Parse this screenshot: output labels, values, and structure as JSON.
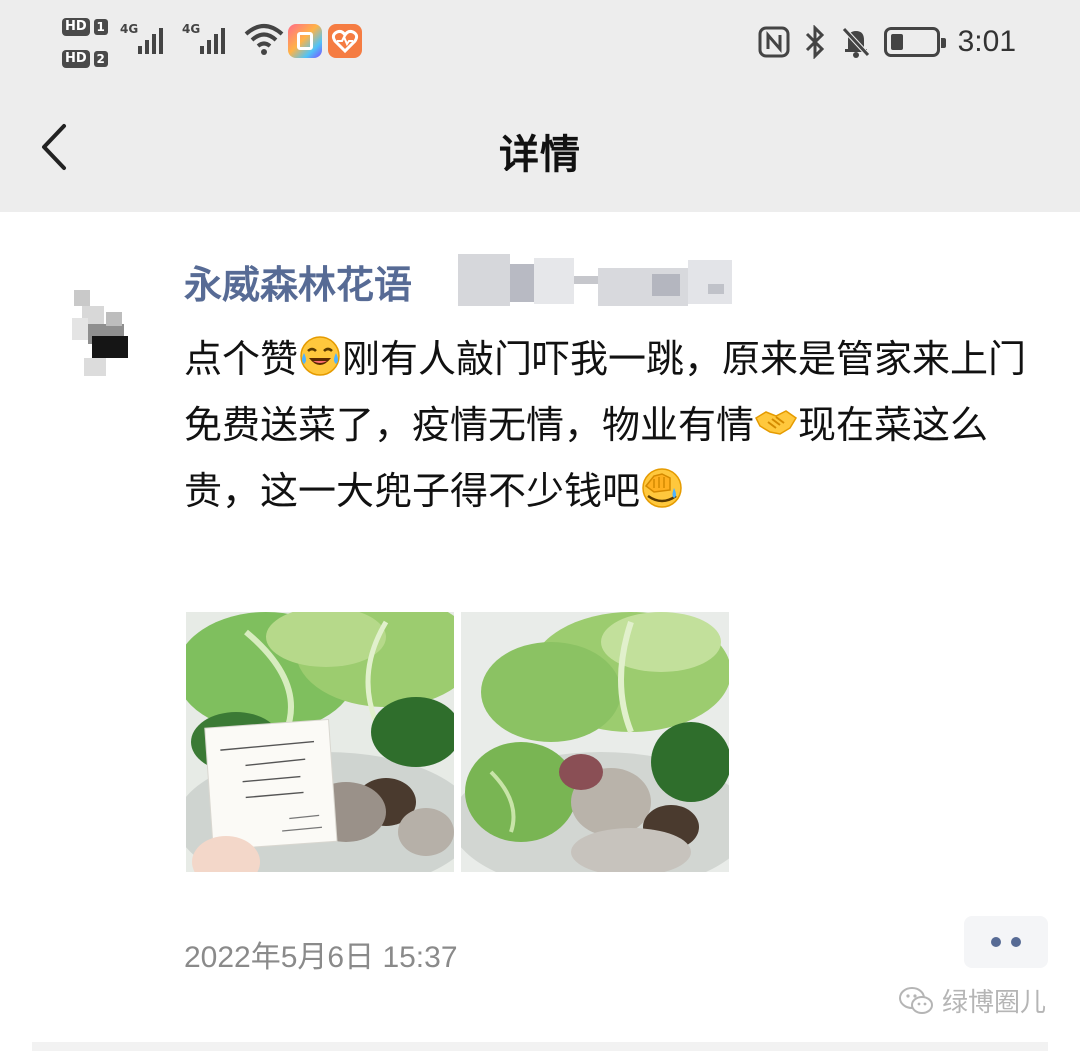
{
  "status_bar": {
    "sim1_badge": "HD",
    "sim1_index": "1",
    "sim2_badge": "HD",
    "sim2_index": "2",
    "network1": "4G",
    "network2": "4G",
    "time": "3:01",
    "icons": [
      "signal-4g-icon",
      "signal-4g-icon",
      "wifi-icon",
      "app-notify-icon",
      "health-app-icon",
      "nfc-icon",
      "bluetooth-icon",
      "mute-bell-icon",
      "battery-icon"
    ]
  },
  "nav": {
    "title": "详情",
    "back_icon": "chevron-left-icon"
  },
  "post": {
    "author": "永威森林花语",
    "text_segments": [
      "点个赞",
      "刚有人敲门吓我一跳，原来是管家来上门免费送菜了，疫情无情，物业有情",
      "现在菜这么贵，这一大兜子得不少钱吧"
    ],
    "emojis": [
      "laughing-tears-emoji",
      "handshake-emoji",
      "facepalm-emoji"
    ],
    "photos": [
      "vegetables-with-note-photo",
      "vegetables-bag-photo"
    ],
    "timestamp": "2022年5月6日 15:37",
    "more_icon": "more-dots-icon"
  },
  "watermark": {
    "text": "绿博圈儿",
    "icon": "wechat-icon"
  },
  "colors": {
    "nav_bg": "#ededed",
    "author": "#576b95",
    "timestamp": "#8a8a8a"
  }
}
